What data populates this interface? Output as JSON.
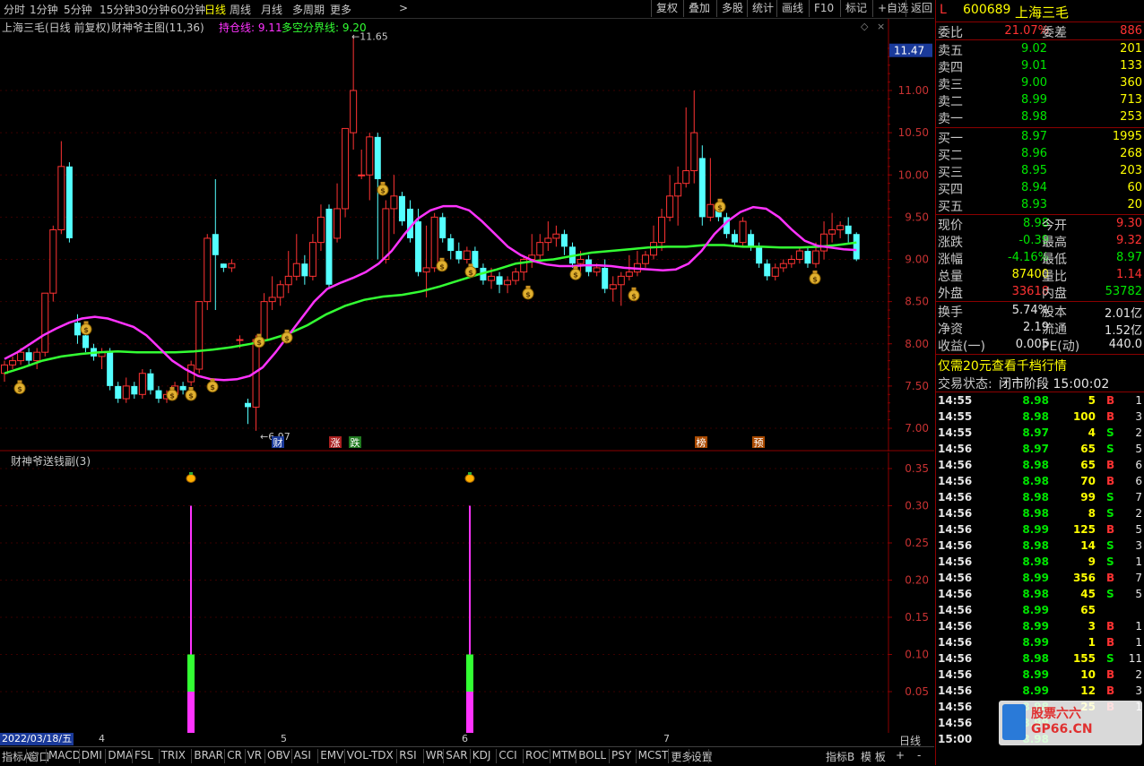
{
  "toolbar": {
    "periods": [
      "分时",
      "1分钟",
      "5分钟",
      "15分钟",
      "30分钟",
      "60分钟",
      "日线",
      "周线",
      "月线",
      "多周期",
      "更多"
    ],
    "active_period": "日线",
    "right_buttons": [
      "复权",
      "叠加",
      "多股",
      "统计",
      "画线",
      "F10",
      "标记",
      "+自选",
      "返回"
    ]
  },
  "main_chart": {
    "title": "上海三毛(日线 前复权)",
    "indicator": "财神爷主图(11,36)",
    "line1_label": "持仓线: 9.11",
    "line2_label": "多空分界线: 9.20",
    "high_label": "11.65",
    "low_label": "6.97",
    "current_price_tag": "11.47",
    "y_ticks": [
      "11.00",
      "10.50",
      "10.00",
      "9.50",
      "9.00",
      "8.50",
      "8.00",
      "7.50",
      "7.00"
    ],
    "markers": [
      "财",
      "涨",
      "跌",
      "榜",
      "预"
    ],
    "colors": {
      "line1": "#ff33ff",
      "line2": "#33ff33",
      "up": "#ff3333",
      "down": "#54ffff"
    }
  },
  "chart_data": {
    "type": "candlestick",
    "ylim": [
      6.9,
      11.8
    ],
    "candles": [
      [
        7.65,
        7.75,
        7.55,
        7.8
      ],
      [
        7.75,
        7.8,
        7.7,
        7.85
      ],
      [
        7.8,
        7.9,
        7.75,
        7.95
      ],
      [
        7.9,
        7.8,
        7.75,
        7.95
      ],
      [
        7.8,
        7.9,
        7.7,
        7.95
      ],
      [
        7.9,
        8.6,
        7.85,
        8.6
      ],
      [
        8.6,
        9.35,
        8.5,
        9.4
      ],
      [
        9.35,
        10.1,
        9.3,
        10.4
      ],
      [
        10.1,
        9.25,
        9.2,
        10.15
      ],
      [
        8.25,
        8.1,
        8.0,
        8.35
      ],
      [
        8.1,
        7.95,
        7.9,
        8.25
      ],
      [
        7.95,
        7.85,
        7.8,
        8.0
      ],
      [
        7.85,
        7.9,
        7.7,
        7.95
      ],
      [
        7.9,
        7.5,
        7.45,
        7.95
      ],
      [
        7.5,
        7.35,
        7.3,
        7.55
      ],
      [
        7.35,
        7.5,
        7.3,
        7.6
      ],
      [
        7.5,
        7.4,
        7.35,
        7.55
      ],
      [
        7.4,
        7.65,
        7.35,
        7.7
      ],
      [
        7.65,
        7.45,
        7.4,
        7.7
      ],
      [
        7.45,
        7.35,
        7.3,
        7.5
      ],
      [
        7.35,
        7.4,
        7.3,
        7.45
      ],
      [
        7.4,
        7.5,
        7.35,
        7.55
      ],
      [
        7.5,
        7.45,
        7.4,
        7.55
      ],
      [
        7.55,
        7.75,
        7.5,
        7.8
      ],
      [
        7.7,
        8.5,
        7.65,
        8.5
      ],
      [
        8.5,
        9.25,
        8.4,
        9.3
      ],
      [
        9.3,
        9.05,
        8.4,
        9.95
      ],
      [
        8.95,
        8.9,
        8.85,
        8.95
      ],
      [
        8.9,
        8.95,
        8.85,
        9.0
      ],
      [
        8.05,
        8.05,
        7.95,
        8.1
      ],
      [
        7.3,
        7.25,
        7.05,
        7.35
      ],
      [
        7.25,
        8.05,
        6.97,
        8.1
      ],
      [
        8.05,
        8.5,
        8.0,
        8.6
      ],
      [
        8.5,
        8.55,
        8.4,
        8.8
      ],
      [
        8.55,
        8.7,
        8.45,
        8.75
      ],
      [
        8.7,
        8.8,
        8.6,
        9.1
      ],
      [
        8.8,
        8.95,
        8.75,
        9.3
      ],
      [
        8.95,
        8.8,
        8.7,
        9.05
      ],
      [
        8.8,
        9.2,
        8.75,
        9.3
      ],
      [
        9.2,
        9.5,
        9.1,
        9.65
      ],
      [
        9.6,
        8.7,
        8.65,
        9.65
      ],
      [
        9.25,
        9.6,
        9.2,
        9.9
      ],
      [
        9.6,
        10.55,
        9.5,
        10.5
      ],
      [
        10.5,
        11.0,
        10.3,
        11.65
      ],
      [
        10.0,
        10.0,
        9.95,
        10.3
      ],
      [
        10.0,
        10.45,
        9.7,
        10.5
      ],
      [
        10.45,
        9.95,
        9.0,
        10.5
      ],
      [
        9.0,
        9.6,
        8.95,
        9.7
      ],
      [
        9.6,
        9.75,
        9.3,
        10.0
      ],
      [
        9.75,
        9.45,
        9.4,
        9.8
      ],
      [
        9.6,
        9.25,
        9.2,
        9.7
      ],
      [
        9.45,
        8.85,
        8.8,
        9.6
      ],
      [
        8.85,
        8.9,
        8.55,
        9.4
      ],
      [
        8.9,
        9.5,
        8.85,
        9.55
      ],
      [
        9.5,
        9.25,
        9.2,
        9.55
      ],
      [
        9.25,
        9.1,
        9.0,
        9.3
      ],
      [
        9.1,
        9.0,
        8.95,
        9.2
      ],
      [
        9.0,
        9.1,
        8.95,
        9.15
      ],
      [
        9.1,
        8.9,
        8.85,
        9.15
      ],
      [
        8.9,
        8.75,
        8.7,
        8.95
      ],
      [
        8.75,
        8.8,
        8.65,
        8.9
      ],
      [
        8.8,
        8.7,
        8.6,
        8.85
      ],
      [
        8.7,
        8.75,
        8.6,
        8.8
      ],
      [
        8.75,
        8.85,
        8.7,
        8.9
      ],
      [
        8.85,
        9.0,
        8.75,
        9.05
      ],
      [
        9.0,
        9.05,
        8.9,
        9.3
      ],
      [
        9.05,
        9.2,
        9.0,
        9.3
      ],
      [
        9.2,
        9.25,
        9.1,
        9.45
      ],
      [
        9.25,
        9.3,
        9.15,
        9.4
      ],
      [
        9.3,
        9.15,
        9.05,
        9.35
      ],
      [
        9.15,
        8.95,
        8.9,
        9.2
      ],
      [
        8.95,
        9.0,
        8.85,
        9.1
      ],
      [
        9.0,
        8.85,
        8.8,
        9.05
      ],
      [
        8.85,
        8.9,
        8.8,
        8.95
      ],
      [
        8.9,
        8.65,
        8.6,
        9.0
      ],
      [
        8.65,
        8.7,
        8.5,
        8.8
      ],
      [
        8.7,
        8.8,
        8.45,
        8.85
      ],
      [
        8.8,
        8.85,
        8.75,
        9.05
      ],
      [
        8.85,
        8.95,
        8.8,
        9.1
      ],
      [
        8.95,
        9.05,
        8.9,
        9.1
      ],
      [
        9.05,
        9.2,
        9.0,
        9.4
      ],
      [
        9.2,
        9.5,
        9.1,
        9.6
      ],
      [
        9.5,
        9.75,
        9.45,
        10.0
      ],
      [
        9.75,
        9.9,
        9.4,
        10.1
      ],
      [
        9.9,
        10.05,
        9.85,
        10.8
      ],
      [
        10.05,
        10.5,
        9.9,
        11.0
      ],
      [
        10.2,
        9.5,
        9.4,
        10.35
      ],
      [
        9.5,
        9.65,
        9.45,
        10.2
      ],
      [
        9.65,
        9.5,
        9.45,
        9.7
      ],
      [
        9.5,
        9.3,
        9.25,
        9.55
      ],
      [
        9.3,
        9.2,
        9.15,
        9.35
      ],
      [
        9.2,
        9.45,
        9.15,
        9.5
      ],
      [
        9.3,
        9.15,
        9.1,
        9.35
      ],
      [
        9.15,
        8.95,
        8.9,
        9.2
      ],
      [
        8.95,
        8.8,
        8.75,
        9.0
      ],
      [
        8.8,
        8.9,
        8.75,
        8.95
      ],
      [
        8.9,
        8.95,
        8.85,
        9.0
      ],
      [
        8.95,
        9.0,
        8.9,
        9.05
      ],
      [
        9.0,
        9.1,
        8.95,
        9.15
      ],
      [
        9.1,
        8.95,
        8.9,
        9.15
      ],
      [
        8.95,
        9.1,
        8.9,
        9.2
      ],
      [
        9.1,
        9.3,
        9.0,
        9.45
      ],
      [
        9.3,
        9.35,
        9.2,
        9.55
      ],
      [
        9.35,
        9.4,
        9.25,
        9.45
      ],
      [
        9.4,
        9.3,
        9.2,
        9.5
      ],
      [
        9.3,
        9.0,
        8.98,
        9.32
      ]
    ],
    "line1": [
      7.82,
      7.9,
      8.0,
      8.1,
      8.18,
      8.25,
      8.3,
      8.32,
      8.3,
      8.25,
      8.2,
      8.1,
      7.95,
      7.8,
      7.7,
      7.62,
      7.58,
      7.57,
      7.58,
      7.62,
      7.72,
      7.9,
      8.1,
      8.3,
      8.5,
      8.65,
      8.72,
      8.78,
      8.85,
      8.95,
      9.1,
      9.3,
      9.48,
      9.58,
      9.63,
      9.63,
      9.58,
      9.45,
      9.3,
      9.15,
      9.05,
      8.98,
      8.94,
      8.92,
      8.92,
      8.93,
      8.93,
      8.92,
      8.9,
      8.89,
      8.88,
      8.87,
      8.88,
      8.95,
      9.1,
      9.3,
      9.45,
      9.56,
      9.62,
      9.6,
      9.5,
      9.35,
      9.22,
      9.16,
      9.14,
      9.12,
      9.11
    ],
    "line2": [
      7.65,
      7.72,
      7.8,
      7.85,
      7.88,
      7.9,
      7.91,
      7.9,
      7.9,
      7.9,
      7.91,
      7.93,
      7.96,
      8.0,
      8.05,
      8.12,
      8.22,
      8.35,
      8.45,
      8.52,
      8.56,
      8.58,
      8.62,
      8.68,
      8.75,
      8.82,
      8.88,
      8.95,
      8.98,
      9.0,
      9.04,
      9.08,
      9.1,
      9.12,
      9.14,
      9.15,
      9.15,
      9.17,
      9.17,
      9.15,
      9.15,
      9.14,
      9.14,
      9.15,
      9.17,
      9.2
    ]
  },
  "sub_chart": {
    "title": "财神爷送钱副(3)",
    "y_ticks": [
      "0.35",
      "0.30",
      "0.25",
      "0.20",
      "0.15",
      "0.10",
      "0.05"
    ],
    "signal_values": [
      0.3,
      0.3
    ]
  },
  "date_axis": {
    "start": "2022/03/18/五",
    "months": [
      "4",
      "5",
      "6",
      "7"
    ],
    "period": "日线"
  },
  "bottom_tabs": [
    "指标A",
    "窗口",
    "MACD",
    "DMI",
    "DMA",
    "FSL",
    "TRIX",
    "BRAR",
    "CR",
    "VR",
    "OBV",
    "ASI",
    "EMV",
    "VOL-TDX",
    "RSI",
    "WR",
    "SAR",
    "KDJ",
    "CCI",
    "ROC",
    "MTM",
    "BOLL",
    "PSY",
    "MCST",
    "更多",
    "设置"
  ],
  "bottom_right": [
    "指标B",
    "模 板",
    "+",
    "-"
  ],
  "quote": {
    "flag": "L",
    "code": "600689",
    "name": "上海三毛",
    "weibi_label": "委比",
    "weibi": "21.07%",
    "weicha_label": "委差",
    "weicha": "886",
    "sell": [
      {
        "label": "卖五",
        "price": "9.02",
        "vol": "201"
      },
      {
        "label": "卖四",
        "price": "9.01",
        "vol": "133"
      },
      {
        "label": "卖三",
        "price": "9.00",
        "vol": "360"
      },
      {
        "label": "卖二",
        "price": "8.99",
        "vol": "713"
      },
      {
        "label": "卖一",
        "price": "8.98",
        "vol": "253"
      }
    ],
    "buy": [
      {
        "label": "买一",
        "price": "8.97",
        "vol": "1995"
      },
      {
        "label": "买二",
        "price": "8.96",
        "vol": "268"
      },
      {
        "label": "买三",
        "price": "8.95",
        "vol": "203"
      },
      {
        "label": "买四",
        "price": "8.94",
        "vol": "60"
      },
      {
        "label": "买五",
        "price": "8.93",
        "vol": "20"
      }
    ],
    "stats": [
      {
        "l1": "现价",
        "v1": "8.98",
        "c1": "green",
        "l2": "今开",
        "v2": "9.30",
        "c2": "red"
      },
      {
        "l1": "涨跌",
        "v1": "-0.39",
        "c1": "green",
        "l2": "最高",
        "v2": "9.32",
        "c2": "red"
      },
      {
        "l1": "涨幅",
        "v1": "-4.16%",
        "c1": "green",
        "l2": "最低",
        "v2": "8.97",
        "c2": "green"
      },
      {
        "l1": "总量",
        "v1": "87400",
        "c1": "yellow",
        "l2": "量比",
        "v2": "1.14",
        "c2": "red"
      },
      {
        "l1": "外盘",
        "v1": "33618",
        "c1": "red",
        "l2": "内盘",
        "v2": "53782",
        "c2": "green"
      }
    ],
    "stats2": [
      {
        "l1": "换手",
        "v1": "5.74%",
        "l2": "股本",
        "v2": "2.01亿"
      },
      {
        "l1": "净资",
        "v1": "2.19",
        "l2": "流通",
        "v2": "1.52亿"
      },
      {
        "l1": "收益(一)",
        "v1": "0.005",
        "l2": "PE(动)",
        "v2": "440.0"
      }
    ],
    "promo": "仅需20元查看千档行情",
    "status_label": "交易状态:",
    "status": "闭市阶段 15:00:02",
    "ticks": [
      [
        "14:55",
        "8.98",
        "5",
        "B",
        "1"
      ],
      [
        "14:55",
        "8.98",
        "100",
        "B",
        "3"
      ],
      [
        "14:55",
        "8.97",
        "4",
        "S",
        "2"
      ],
      [
        "14:56",
        "8.97",
        "65",
        "S",
        "5"
      ],
      [
        "14:56",
        "8.98",
        "65",
        "B",
        "6"
      ],
      [
        "14:56",
        "8.98",
        "70",
        "B",
        "6"
      ],
      [
        "14:56",
        "8.98",
        "99",
        "S",
        "7"
      ],
      [
        "14:56",
        "8.98",
        "8",
        "S",
        "2"
      ],
      [
        "14:56",
        "8.99",
        "125",
        "B",
        "5"
      ],
      [
        "14:56",
        "8.98",
        "14",
        "S",
        "3"
      ],
      [
        "14:56",
        "8.98",
        "9",
        "S",
        "1"
      ],
      [
        "14:56",
        "8.99",
        "356",
        "B",
        "7"
      ],
      [
        "14:56",
        "8.98",
        "45",
        "S",
        "5"
      ],
      [
        "14:56",
        "8.99",
        "65",
        "",
        ""
      ],
      [
        "14:56",
        "8.99",
        "3",
        "B",
        "1"
      ],
      [
        "14:56",
        "8.99",
        "1",
        "B",
        "1"
      ],
      [
        "14:56",
        "8.98",
        "155",
        "S",
        "11"
      ],
      [
        "14:56",
        "8.99",
        "10",
        "B",
        "2"
      ],
      [
        "14:56",
        "8.99",
        "12",
        "B",
        "3"
      ],
      [
        "14:56",
        "8.98",
        "25",
        "B",
        "1"
      ],
      [
        "14:56",
        "8.99",
        "",
        "",
        ""
      ],
      [
        "15:00",
        "8.98",
        "",
        "",
        ""
      ]
    ]
  },
  "watermark": "股票六六 GP66.CN"
}
